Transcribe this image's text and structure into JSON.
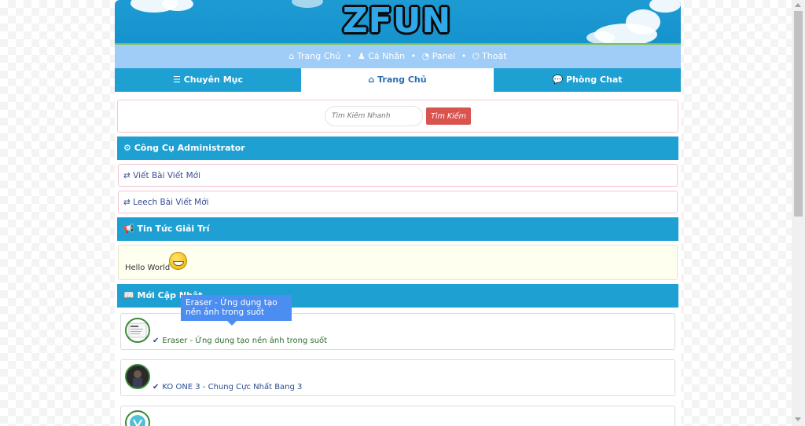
{
  "logo": "ZFUN",
  "topnav": {
    "items": [
      "Trang Chủ",
      "Cá Nhân",
      "Panel",
      "Thoát"
    ]
  },
  "tabs": [
    {
      "label": "Chuyên Mục",
      "active": false
    },
    {
      "label": "Trang Chủ",
      "active": true
    },
    {
      "label": "Phòng Chat",
      "active": false
    }
  ],
  "search": {
    "placeholder": "Tìm Kiếm Nhanh",
    "button": "Tìm Kiếm"
  },
  "admin": {
    "heading": "Công Cụ Administrator",
    "links": [
      "Viết Bài Viết Mới",
      "Leech Bài Viết Mới"
    ]
  },
  "news": {
    "heading": "Tin Tức Giải Trí",
    "text": "Hello World"
  },
  "updates": {
    "heading": "Mới Cập Nhật",
    "posts": [
      {
        "title": "Eraser - Ứng dụng tạo nền ảnh trong suốt"
      },
      {
        "title": "KO ONE 3 - Chung Cực Nhất Bang 3"
      },
      {
        "title": ""
      }
    ]
  },
  "tooltip": "Eraser - Ứng dụng tạo nền ảnh trong suốt",
  "colors": {
    "accent": "#1fa0d2",
    "topnav": "#9fcdf8",
    "search_button": "#d9534f",
    "tooltip": "#4c8df2"
  }
}
